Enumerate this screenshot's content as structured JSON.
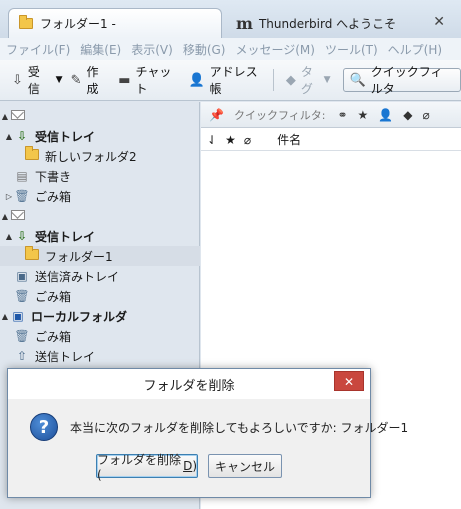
{
  "tabs": [
    {
      "label": "フォルダー1 -",
      "icon": "folder-icon"
    },
    {
      "label": "Thunderbird へようこそ",
      "icon": "thunderbird-logo-icon",
      "logo_text": "m"
    }
  ],
  "tab_close": "✕",
  "menu": [
    "ファイル(F)",
    "編集(E)",
    "表示(V)",
    "移動(G)",
    "メッセージ(M)",
    "ツール(T)",
    "ヘルプ(H)"
  ],
  "toolbar": {
    "receive": "受信",
    "compose": "作成",
    "chat": "チャット",
    "addressbook": "アドレス帳",
    "tag": "タグ",
    "quickfilter": "クイックフィルタ"
  },
  "folders": [
    {
      "label": "",
      "icon": "envelope-icon",
      "bold": false,
      "twisty": "▲"
    },
    {
      "label": "受信トレイ",
      "icon": "inbox-icon",
      "bold": true,
      "twisty": "▲"
    },
    {
      "label": "新しいフォルダ2",
      "icon": "folder-icon",
      "bold": false,
      "twisty": ""
    },
    {
      "label": "下書き",
      "icon": "drafts-icon",
      "bold": false,
      "twisty": ""
    },
    {
      "label": "ごみ箱",
      "icon": "trash-icon",
      "bold": false,
      "twisty": "▷"
    },
    {
      "label": "",
      "icon": "envelope-icon",
      "bold": false,
      "twisty": "▲"
    },
    {
      "label": "受信トレイ",
      "icon": "inbox-icon",
      "bold": true,
      "twisty": "▲"
    },
    {
      "label": "フォルダー1",
      "icon": "folder-icon",
      "bold": false,
      "twisty": "",
      "selected": true
    },
    {
      "label": "送信済みトレイ",
      "icon": "sent-icon",
      "bold": false,
      "twisty": ""
    },
    {
      "label": "ごみ箱",
      "icon": "trash-icon",
      "bold": false,
      "twisty": ""
    },
    {
      "label": "ローカルフォルダ",
      "icon": "computer-icon",
      "bold": true,
      "twisty": "▲"
    },
    {
      "label": "ごみ箱",
      "icon": "trash-icon",
      "bold": false,
      "twisty": ""
    },
    {
      "label": "送信トレイ",
      "icon": "outbox-icon",
      "bold": false,
      "twisty": ""
    }
  ],
  "quickfilter_bar": {
    "label": "クイックフィルタ:"
  },
  "columns": {
    "subject": "件名"
  },
  "dialog": {
    "title": "フォルダを削除",
    "message": "本当に次のフォルダを削除してもよろしいですか: フォルダー1",
    "delete_label": "フォルダを削除(",
    "delete_accel": "D",
    "delete_suffix": ")",
    "cancel_label": "キャンセル"
  }
}
